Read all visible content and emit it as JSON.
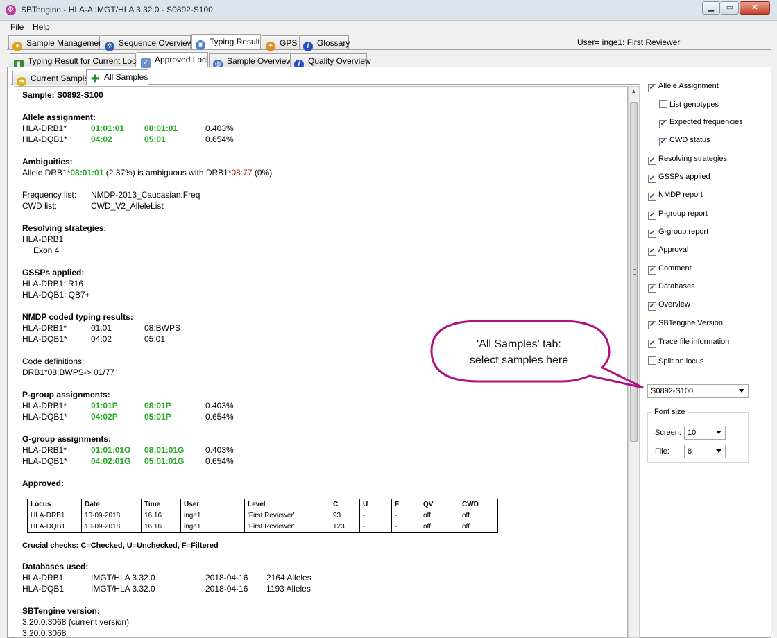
{
  "window": {
    "title": "SBTengine - HLA-A IMGT/HLA 3.32.0 - S0892-S100",
    "min_label": "▁",
    "max_label": "▭",
    "close_label": "✕"
  },
  "menu": [
    "File",
    "Help"
  ],
  "main_tabs": [
    {
      "label": "Sample Management",
      "icon": "sample-management-icon"
    },
    {
      "label": "Sequence Overview",
      "icon": "sequence-overview-icon"
    },
    {
      "label": "Typing Result",
      "icon": "typing-result-icon"
    },
    {
      "label": "GPS",
      "icon": "gps-icon"
    },
    {
      "label": "Glossary",
      "icon": "info-icon"
    }
  ],
  "user_text": "User= inge1: First Reviewer",
  "sub_tabs": [
    {
      "label": "Typing Result for Current Locus",
      "icon": "book-icon"
    },
    {
      "label": "Approved Loci",
      "icon": "checklist-icon"
    },
    {
      "label": "Sample Overview",
      "icon": "sample-overview-icon"
    },
    {
      "label": "Quality Overview",
      "icon": "info-icon"
    }
  ],
  "sample_tabs": [
    {
      "label": "Current Sample",
      "icon": "arrow-icon"
    },
    {
      "label": "All Samples",
      "icon": "plus-icon"
    }
  ],
  "report": {
    "sample_title": "Sample: S0892-S100",
    "allele_heading": "Allele assignment:",
    "allele_rows": [
      {
        "locus": "HLA-DRB1*",
        "a1": "01:01:01",
        "a2": "08:01:01",
        "freq": "0.403%"
      },
      {
        "locus": "HLA-DQB1*",
        "a1": "04:02",
        "a2": "05:01",
        "freq": "0.654%"
      }
    ],
    "ambiguities_heading": "Ambiguities:",
    "amb_prefix": "Allele DRB1*",
    "amb_allele": "08:01:01",
    "amb_mid": " (2.37%) is ambiguous with DRB1*",
    "amb_other": "08:77",
    "amb_suffix": " (0%)",
    "freq_list_label": "Frequency list:",
    "freq_list_value": "NMDP-2013_Caucasian.Freq",
    "cwd_list_label": "CWD list:",
    "cwd_list_value": "CWD_V2_AlleleList",
    "resolving_heading": "Resolving strategies:",
    "resolving_locus": "HLA-DRB1",
    "resolving_item": "Exon 4",
    "gssp_heading": "GSSPs applied:",
    "gssp_lines": [
      "HLA-DRB1: R16",
      "HLA-DQB1: QB7+"
    ],
    "nmdp_heading": "NMDP coded typing results:",
    "nmdp_rows": [
      {
        "locus": "HLA-DRB1*",
        "a1": "01:01",
        "a2": "08:BWPS"
      },
      {
        "locus": "HLA-DQB1*",
        "a1": "04:02",
        "a2": "05:01"
      }
    ],
    "code_def_label": "Code definitions:",
    "code_def_value": "DRB1*08:BWPS-> 01/77",
    "pgroup_heading": "P-group assignments:",
    "pgroup_rows": [
      {
        "locus": "HLA-DRB1*",
        "a1": "01:01P",
        "a2": "08:01P",
        "freq": "0.403%"
      },
      {
        "locus": "HLA-DQB1*",
        "a1": "04:02P",
        "a2": "05:01P",
        "freq": "0.654%"
      }
    ],
    "ggroup_heading": "G-group assignments:",
    "ggroup_rows": [
      {
        "locus": "HLA-DRB1*",
        "a1": "01:01:01G",
        "a2": "08:01:01G",
        "freq": "0.403%"
      },
      {
        "locus": "HLA-DQB1*",
        "a1": "04:02:01G",
        "a2": "05:01:01G",
        "freq": "0.654%"
      }
    ],
    "approved_heading": "Approved:",
    "approved_columns": [
      "Locus",
      "Date",
      "Time",
      "User",
      "Level",
      "C",
      "U",
      "F",
      "QV",
      "CWD"
    ],
    "approved_rows": [
      [
        "HLA-DRB1",
        "10-09-2018",
        "16:16",
        "inge1",
        "'First Reviewer'",
        "93",
        "-",
        "-",
        "off",
        "off"
      ],
      [
        "HLA-DQB1",
        "10-09-2018",
        "16:16",
        "inge1",
        "'First Reviewer'",
        "123",
        "-",
        "-",
        "off",
        "off"
      ]
    ],
    "crucial_checks": "Crucial checks: C=Checked, U=Unchecked, F=Filtered",
    "databases_heading": "Databases used:",
    "database_rows": [
      {
        "locus": "HLA-DRB1",
        "db": "IMGT/HLA 3.32.0",
        "date": "2018-04-16",
        "alleles": "2164 Alleles"
      },
      {
        "locus": "HLA-DQB1",
        "db": "IMGT/HLA 3.32.0",
        "date": "2018-04-16",
        "alleles": "1193 Alleles"
      }
    ],
    "version_heading": "SBTengine version:",
    "version_lines": [
      "3.20.0.3068 (current version)",
      "3.20.0.3068"
    ]
  },
  "options": [
    {
      "label": "Allele Assignment",
      "checked": true,
      "sub": false
    },
    {
      "label": "List genotypes",
      "checked": false,
      "sub": true
    },
    {
      "label": "Expected frequencies",
      "checked": true,
      "sub": true
    },
    {
      "label": "CWD status",
      "checked": true,
      "sub": true
    },
    {
      "label": "Resolving strategies",
      "checked": true,
      "sub": false
    },
    {
      "label": "GSSPs applied",
      "checked": true,
      "sub": false
    },
    {
      "label": "NMDP report",
      "checked": true,
      "sub": false
    },
    {
      "label": "P-group report",
      "checked": true,
      "sub": false
    },
    {
      "label": "G-group report",
      "checked": true,
      "sub": false
    },
    {
      "label": "Approval",
      "checked": true,
      "sub": false
    },
    {
      "label": "Comment",
      "checked": true,
      "sub": false
    },
    {
      "label": "Databases",
      "checked": true,
      "sub": false
    },
    {
      "label": "Overview",
      "checked": true,
      "sub": false
    },
    {
      "label": "SBTengine Version",
      "checked": true,
      "sub": false
    },
    {
      "label": "Trace file information",
      "checked": true,
      "sub": false
    },
    {
      "label": "Split on locus",
      "checked": false,
      "sub": false
    }
  ],
  "sample_select": {
    "value": "S0892-S100"
  },
  "font_size": {
    "title": "Font size",
    "screen_label": "Screen:",
    "screen_value": "10",
    "file_label": "File:",
    "file_value": "8"
  },
  "callout": {
    "line1": "'All Samples' tab:",
    "line2": "select samples here",
    "color": "#b0127a"
  }
}
